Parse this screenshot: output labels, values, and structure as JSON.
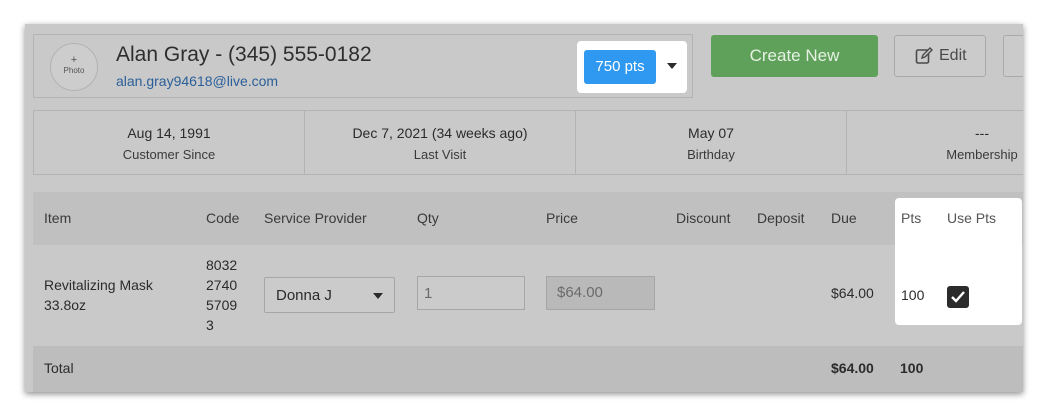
{
  "customer": {
    "photo_plus": "+",
    "photo_label": "Photo",
    "name_phone": "Alan Gray - (345) 555-0182",
    "email": "alan.gray94618@live.com"
  },
  "points": {
    "balance_label": "750 pts"
  },
  "actions": {
    "create_new": "Create New",
    "edit": "Edit"
  },
  "stats": [
    {
      "value": "Aug 14, 1991",
      "label": "Customer Since"
    },
    {
      "value": "Dec 7, 2021 (34 weeks ago)",
      "label": "Last Visit"
    },
    {
      "value": "May 07",
      "label": "Birthday"
    },
    {
      "value": "---",
      "label": "Membership"
    }
  ],
  "table": {
    "headers": {
      "item": "Item",
      "code": "Code",
      "provider": "Service Provider",
      "qty": "Qty",
      "price": "Price",
      "discount": "Discount",
      "deposit": "Deposit",
      "due": "Due",
      "pts": "Pts",
      "use_pts": "Use Pts"
    },
    "row": {
      "item_line1": "Revitalizing Mask",
      "item_line2": "33.8oz",
      "code_lines": [
        "8032",
        "2740",
        "5709",
        "3"
      ],
      "provider": "Donna J",
      "qty": "1",
      "price": "$64.00",
      "due": "$64.00",
      "pts": "100",
      "use_pts_checked": true
    },
    "footer": {
      "label": "Total",
      "due": "$64.00",
      "pts": "100"
    }
  },
  "colors": {
    "accent_blue": "#2f98f0",
    "create_green": "#5fa05a",
    "email_link": "#2a5f99"
  }
}
